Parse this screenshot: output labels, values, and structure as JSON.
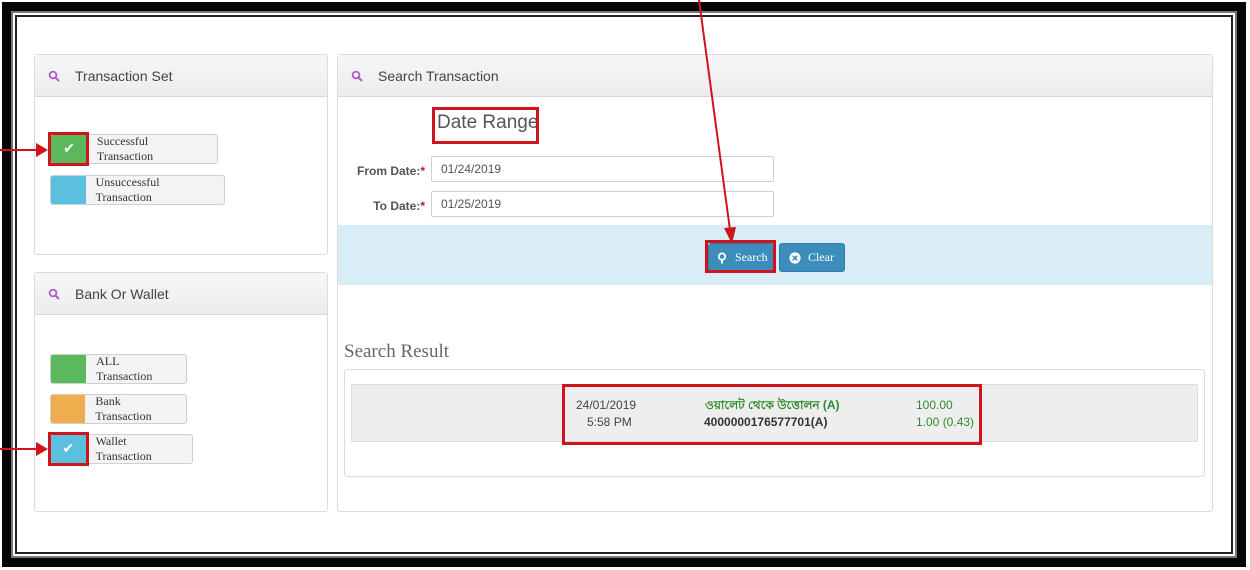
{
  "transaction_set": {
    "title": "Transaction Set",
    "options": [
      {
        "label": "Successful Transaction",
        "color": "#5cb85c",
        "checked": true
      },
      {
        "label": "Unsuccessful Transaction",
        "color": "#5bc0de",
        "checked": false
      }
    ]
  },
  "bank_or_wallet": {
    "title": "Bank Or Wallet",
    "options": [
      {
        "label": "ALL Transaction",
        "color": "#5cb85c",
        "checked": false
      },
      {
        "label": "Bank Transaction",
        "color": "#f0ad4e",
        "checked": false
      },
      {
        "label": "Wallet Transaction",
        "color": "#5bc0de",
        "checked": true
      }
    ]
  },
  "search_panel": {
    "title": "Search Transaction",
    "date_range_heading": "Date Range",
    "from_label": "From Date:",
    "from_value": "01/24/2019",
    "to_label": "To Date:",
    "to_value": "01/25/2019",
    "required_marker": "*",
    "search_label": "Search",
    "clear_label": "Clear"
  },
  "results": {
    "heading": "Search Result",
    "rows": [
      {
        "date": "24/01/2019",
        "time": "5:58 PM",
        "description": "ওয়ালেট থেকে উত্তোলন (A)",
        "account": "4000000176577701(A)",
        "amount": "100.00",
        "fee": "1.00 (0.43)"
      }
    ]
  },
  "colors": {
    "accent_blue": "#3c8dbc",
    "annotation_red": "#d0141d",
    "icon_purple": "#b05bc8",
    "amount_green": "#2e8b2e"
  }
}
